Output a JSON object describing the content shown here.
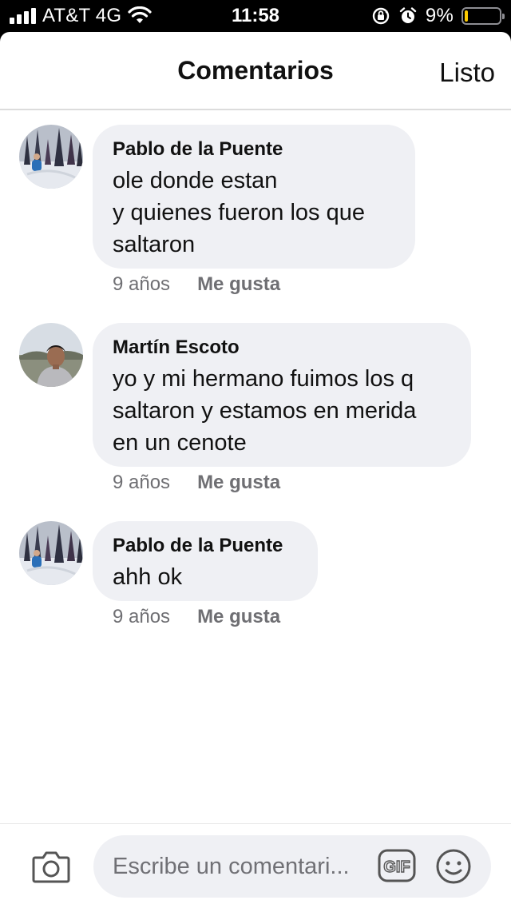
{
  "status_bar": {
    "carrier": "AT&T 4G",
    "time": "11:58",
    "battery": "9%",
    "battery_level": 0.09,
    "icons": [
      "signal-icon",
      "wifi-icon",
      "orientation-lock-icon",
      "alarm-icon",
      "battery-icon"
    ]
  },
  "header": {
    "title": "Comentarios",
    "done_label": "Listo"
  },
  "comments": [
    {
      "author": "Pablo de la Puente",
      "lines": [
        "ole donde estan",
        "y quienes fueron los que",
        "saltaron"
      ],
      "time": "9 años",
      "like_label": "Me gusta"
    },
    {
      "author": "Martín Escoto",
      "lines": [
        "yo y mi hermano fuimos los q",
        "saltaron y estamos en merida",
        "en un cenote"
      ],
      "time": "9 años",
      "like_label": "Me gusta"
    },
    {
      "author": "Pablo de la Puente",
      "lines": [
        "ahh ok"
      ],
      "time": "9 años",
      "like_label": "Me gusta"
    }
  ],
  "composer": {
    "placeholder": "Escribe un comentari...",
    "gif_label": "GIF",
    "icons": [
      "camera-icon",
      "gif-icon",
      "smile-icon"
    ]
  },
  "colors": {
    "bubble": "#eff0f4",
    "meta_text": "#6f6f73",
    "battery_fill": "#ffcc00"
  }
}
